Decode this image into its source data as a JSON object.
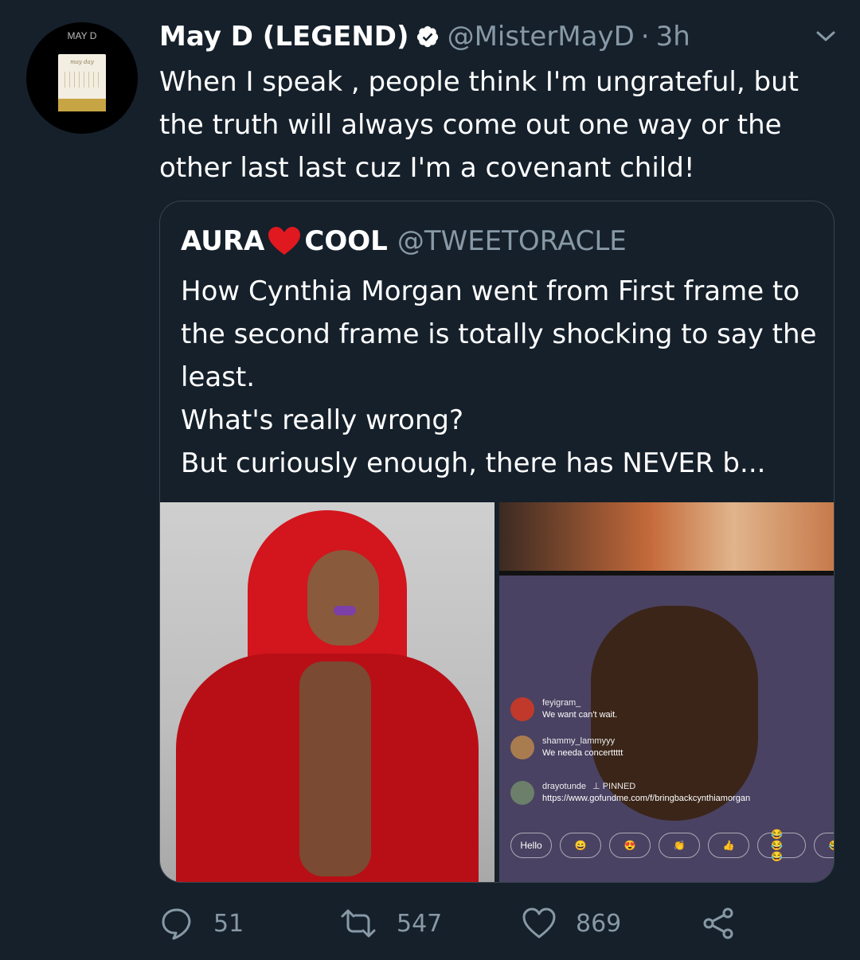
{
  "tweet": {
    "avatar_label": "MAY D",
    "avatar_card_text": "may day",
    "display_name": "May D (LEGEND)",
    "handle": "@MisterMayD",
    "separator": "·",
    "time": "3h",
    "text": "When I speak , people think I'm ungrateful, but the truth will always come out one way or the other last last cuz I'm a covenant child!"
  },
  "quoted": {
    "name_left": "AURA",
    "name_right": "COOL",
    "handle": "@TWEETORACLE",
    "text": "How Cynthia Morgan went from First frame to the second frame is totally shocking to say the least.\nWhat's really wrong?\nBut curiously enough, there has NEVER b..."
  },
  "live_overlay": {
    "comments": [
      {
        "user": "feyigram_",
        "text": "We want can't wait.",
        "avatar_color": "#c0392b"
      },
      {
        "user": "shammy_lammyyy",
        "text": "We needa concerttttt",
        "avatar_color": "#a97c50"
      },
      {
        "user": "drayotunde",
        "pinned": "PINNED",
        "text": "https://www.gofundme.com/f/bringbackcynthiamorgan",
        "avatar_color": "#6b7f6a"
      }
    ],
    "pills": [
      "Hello",
      "😄",
      "😍",
      "👏",
      "👍",
      "😂😂😂",
      "😂"
    ]
  },
  "actions": {
    "replies": "51",
    "retweets": "547",
    "likes": "869"
  },
  "colors": {
    "background": "#15202b",
    "secondary_text": "#8899a6",
    "border": "#38444d",
    "heart": "#e0245e"
  }
}
